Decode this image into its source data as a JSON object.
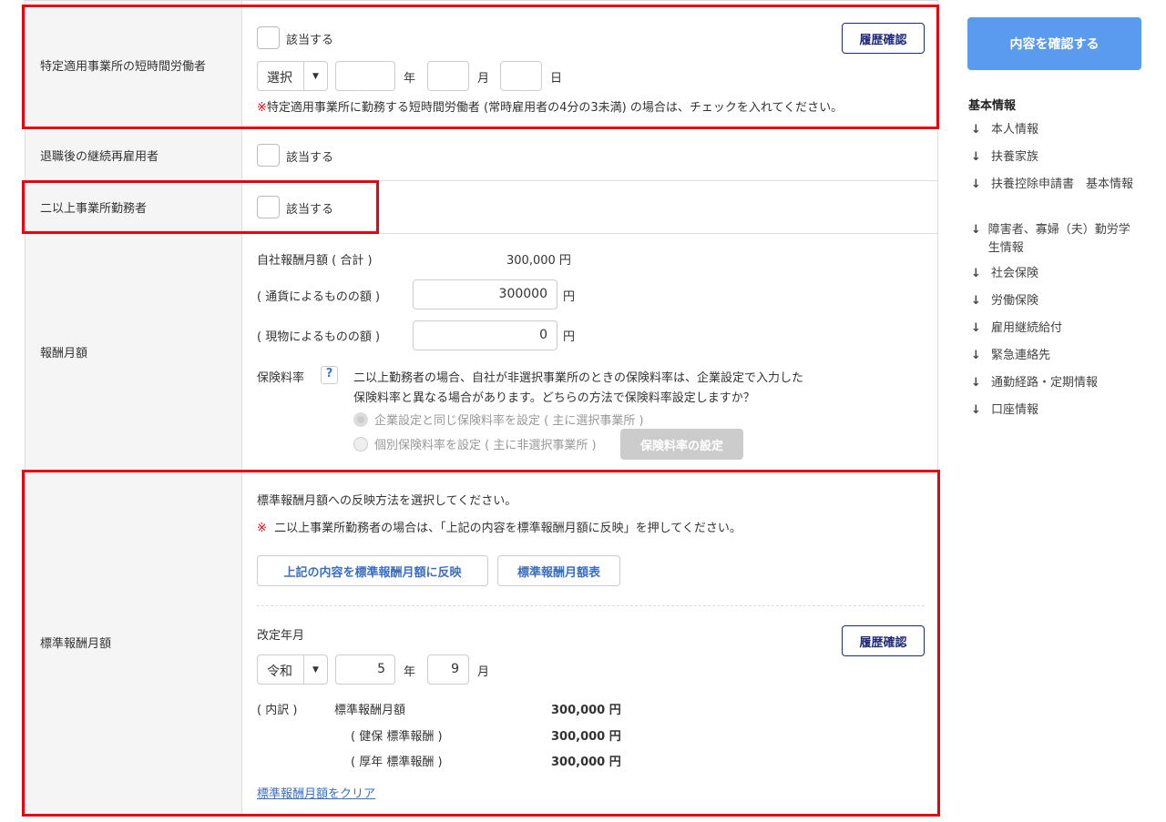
{
  "rows": {
    "part_timer": {
      "label": "特定適用事業所の短時間労働者",
      "checkbox": "該当する",
      "history": "履歴確認",
      "era": "選択",
      "year_unit": "年",
      "month_unit": "月",
      "day_unit": "日",
      "note_mark": "※",
      "note": "特定適用事業所に勤務する短時間労働者 (常時雇用者の4分の3未満) の場合は、チェックを入れてください。"
    },
    "rehired": {
      "label": "退職後の継続再雇用者",
      "checkbox": "該当する"
    },
    "multi": {
      "label": "二以上事業所勤務者",
      "checkbox": "該当する"
    },
    "salary": {
      "label": "報酬月額",
      "total_label": "自社報酬月額 ( 合計 )",
      "total_value": "300,000 円",
      "cash_label": "( 通貨によるものの額 )",
      "cash_value": "300000",
      "kind_label": "( 現物によるものの額 )",
      "kind_value": "0",
      "yen": "円",
      "rate_label": "保険料率",
      "help": "?",
      "rate_text1": "二以上勤務者の場合、自社が非選択事業所のときの保険料率は、企業設定で入力した",
      "rate_text2": "保険料率と異なる場合があります。どちらの方法で保険料率設定しますか？",
      "radio1": "企業設定と同じ保険料率を設定 ( 主に選択事業所 )",
      "radio2": "個別保険料率を設定 ( 主に非選択事業所 )",
      "rate_button": "保険料率の設定"
    },
    "standard": {
      "label": "標準報酬月額",
      "intro": "標準報酬月額への反映方法を選択してください。",
      "note_mark": "※",
      "note": "二以上事業所勤務者の場合は、「上記の内容を標準報酬月額に反映」を押してください。",
      "reflect_button": "上記の内容を標準報酬月額に反映",
      "table_button": "標準報酬月額表",
      "revision_label": "改定年月",
      "history": "履歴確認",
      "era": "令和",
      "year": "5",
      "year_unit": "年",
      "month": "9",
      "month_unit": "月",
      "breakdown": "( 内訳 )",
      "items": [
        {
          "label": "標準報酬月額",
          "value": "300,000 円"
        },
        {
          "label": "( 健保 標準報酬 )",
          "value": "300,000 円"
        },
        {
          "label": "( 厚年 標準報酬 )",
          "value": "300,000 円"
        }
      ],
      "clear_link": "標準報酬月額をクリア"
    }
  },
  "sidebar": {
    "confirm_button": "内容を確認する",
    "heading": "基本情報",
    "arrow": "↓",
    "items": [
      "本人情報",
      "扶養家族",
      "扶養控除申請書　基本情報",
      "障害者、寡婦（夫）勤労学生情報",
      "社会保険",
      "労働保険",
      "雇用継続給付",
      "緊急連絡先",
      "通勤経路・定期情報",
      "口座情報"
    ]
  },
  "colors": {
    "accent": "#5b9bef",
    "highlight": "#e60012"
  }
}
